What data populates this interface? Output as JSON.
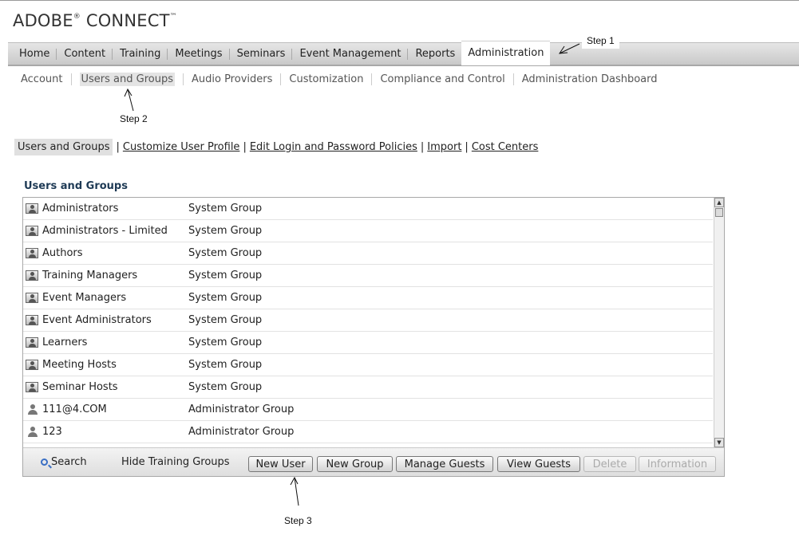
{
  "logo": {
    "text": "ADOBE",
    "reg": "®",
    "text2": " CONNECT",
    "tm": "™"
  },
  "main_nav": [
    "Home",
    "Content",
    "Training",
    "Meetings",
    "Seminars",
    "Event Management",
    "Reports",
    "Administration"
  ],
  "main_nav_active": "Administration",
  "sub_nav": [
    "Account",
    "Users and Groups",
    "Audio Providers",
    "Customization",
    "Compliance and Control",
    "Administration Dashboard"
  ],
  "sub_nav_active": "Users and Groups",
  "links": {
    "current": "Users and Groups",
    "sep": "|",
    "items": [
      "Customize User Profile",
      "Edit Login and Password Policies",
      "Import",
      "Cost Centers"
    ]
  },
  "panel_title": "Users and Groups",
  "rows": [
    {
      "name": "Administrators",
      "type": "System Group",
      "icon": "group-icon"
    },
    {
      "name": "Administrators - Limited",
      "type": "System Group",
      "icon": "group-icon"
    },
    {
      "name": "Authors",
      "type": "System Group",
      "icon": "group-icon"
    },
    {
      "name": "Training Managers",
      "type": "System Group",
      "icon": "group-icon"
    },
    {
      "name": "Event Managers",
      "type": "System Group",
      "icon": "group-icon"
    },
    {
      "name": "Event Administrators",
      "type": "System Group",
      "icon": "group-icon"
    },
    {
      "name": "Learners",
      "type": "System Group",
      "icon": "group-icon"
    },
    {
      "name": "Meeting Hosts",
      "type": "System Group",
      "icon": "group-icon"
    },
    {
      "name": "Seminar Hosts",
      "type": "System Group",
      "icon": "group-icon"
    },
    {
      "name": "111@4.COM",
      "type": "Administrator Group",
      "icon": "users-icon"
    },
    {
      "name": "123",
      "type": "Administrator Group",
      "icon": "users-icon"
    }
  ],
  "toolbar": {
    "search": "Search",
    "hide": "Hide Training Groups",
    "new_user": "New User",
    "new_group": "New Group",
    "manage_guests": "Manage Guests",
    "view_guests": "View Guests",
    "delete": "Delete",
    "information": "Information"
  },
  "annotations": {
    "step1": "Step 1",
    "step2": "Step 2",
    "step3": "Step 3"
  }
}
